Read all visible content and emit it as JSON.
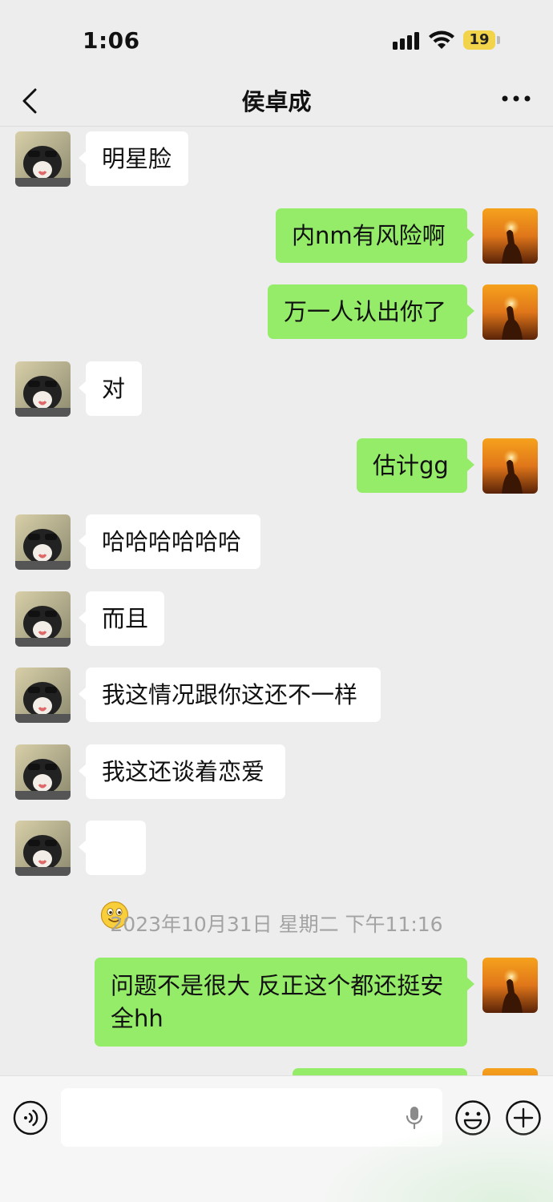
{
  "status_bar": {
    "time": "1:06",
    "battery": "19"
  },
  "nav": {
    "title": "侯卓成"
  },
  "messages": [
    {
      "side": "in",
      "text": "明星脸"
    },
    {
      "side": "out",
      "text": "内nm有风险啊"
    },
    {
      "side": "out",
      "text": "万一人认出你了"
    },
    {
      "side": "in",
      "text": "对"
    },
    {
      "side": "out",
      "text": "估计gg"
    },
    {
      "side": "in",
      "text": "哈哈哈哈哈哈"
    },
    {
      "side": "in",
      "text": "而且"
    },
    {
      "side": "in",
      "text": "我这情况跟你这还不一样"
    },
    {
      "side": "in",
      "text": "我这还谈着恋爱"
    },
    {
      "side": "in",
      "emoji": "smile-emoji"
    },
    {
      "side": "out",
      "text": "问题不是很大 反正这个都还挺安\n全hh"
    },
    {
      "side": "out",
      "text": ""
    }
  ],
  "timestamp": "2023年10月31日 星期二 下午11:16",
  "input": {
    "value": "",
    "placeholder": ""
  },
  "colors": {
    "incoming": "#ffffff",
    "outgoing": "#95ec69",
    "background": "#ededed"
  }
}
